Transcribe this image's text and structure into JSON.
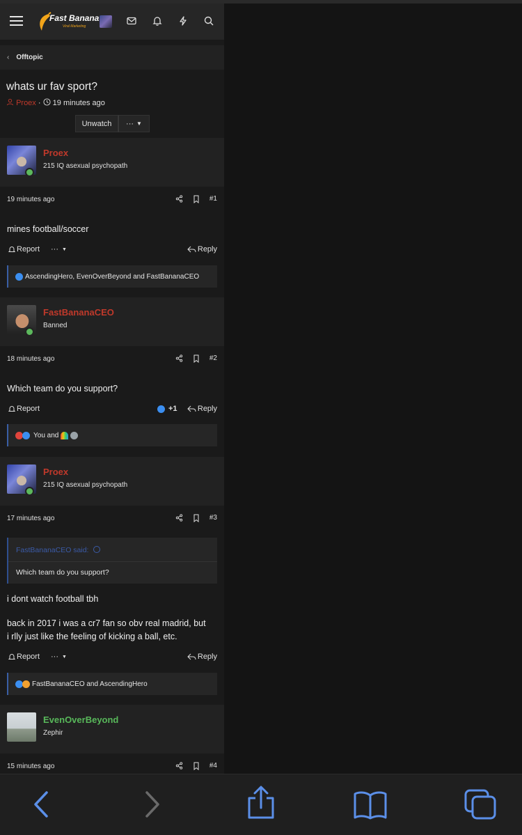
{
  "header": {
    "logo_text": "Fast Banana",
    "logo_subtext": "Viral Marketing",
    "icons": [
      "menu-icon",
      "mail-icon",
      "bell-icon",
      "bolt-icon",
      "search-icon"
    ]
  },
  "breadcrumb": {
    "label": "Offtopic"
  },
  "thread": {
    "title": "whats ur fav sport?",
    "author": "Proex",
    "separator": "·",
    "time": "19 minutes ago",
    "unwatch_label": "Unwatch",
    "more_label": "···"
  },
  "posts": [
    {
      "username": "Proex",
      "user_title": "215 IQ asexual psychopath",
      "time": "19 minutes ago",
      "number": "#1",
      "lines": [
        "mines football/soccer"
      ],
      "report_label": "Report",
      "more_label": "···",
      "reply_label": "Reply",
      "reactions": "AscendingHero, EvenOverBeyond and FastBananaCEO"
    },
    {
      "username": "FastBananaCEO",
      "user_title": "Banned",
      "time": "18 minutes ago",
      "number": "#2",
      "lines": [
        "Which team do you support?"
      ],
      "report_label": "Report",
      "plus_label": "+1",
      "reply_label": "Reply",
      "reactions": "You and"
    },
    {
      "username": "Proex",
      "user_title": "215 IQ asexual psychopath",
      "time": "17 minutes ago",
      "number": "#3",
      "quote_author": "FastBananaCEO said:",
      "quote_text": "Which team do you support?",
      "lines": [
        "i dont watch football tbh",
        "back in 2017 i was a cr7 fan so obv real madrid, but",
        "i rlly just like the feeling of kicking a ball, etc."
      ],
      "report_label": "Report",
      "more_label": "···",
      "reply_label": "Reply",
      "reactions": "FastBananaCEO and AscendingHero"
    },
    {
      "username": "EvenOverBeyond",
      "user_title": "Zephir",
      "time": "15 minutes ago",
      "number": "#4"
    }
  ],
  "colors": {
    "background": "#1a1a1a",
    "panel": "#222222",
    "username_red": "#c0392b",
    "username_green": "#58b85a",
    "link_blue": "#3b5ba8",
    "toolbar_icon_blue": "#5b8fe8"
  },
  "toolbar": {
    "icons": [
      "back-arrow-icon",
      "forward-arrow-icon",
      "share-icon",
      "bookmarks-icon",
      "tabs-icon"
    ]
  }
}
